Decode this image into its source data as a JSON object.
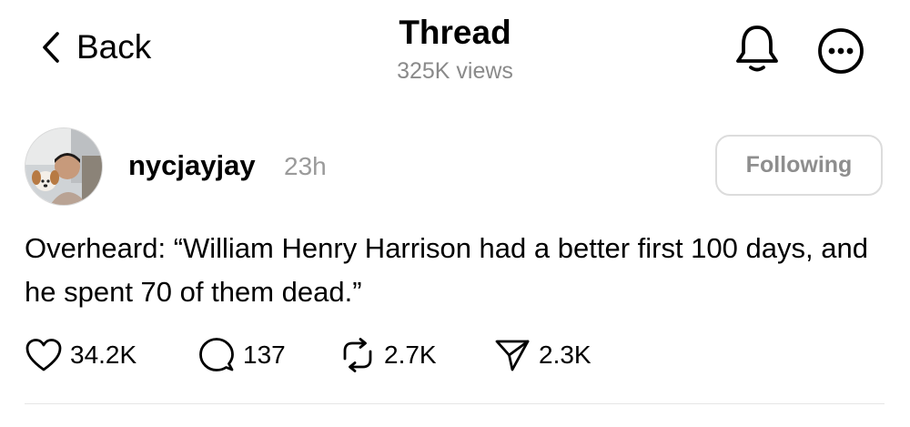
{
  "header": {
    "back_label": "Back",
    "title": "Thread",
    "views": "325K views"
  },
  "post": {
    "username": "nycjayjay",
    "time": "23h",
    "follow_label": "Following",
    "text": "Overheard: “William Henry Harrison had a better first 100 days, and he spent 70 of them dead.”",
    "likes": "34.2K",
    "replies": "137",
    "reposts": "2.7K",
    "shares": "2.3K"
  },
  "icons": {
    "back": "chevron-left-icon",
    "notifications": "bell-icon",
    "more": "more-horizontal-icon",
    "like": "heart-icon",
    "reply": "comment-icon",
    "repost": "repost-icon",
    "share": "send-icon"
  }
}
